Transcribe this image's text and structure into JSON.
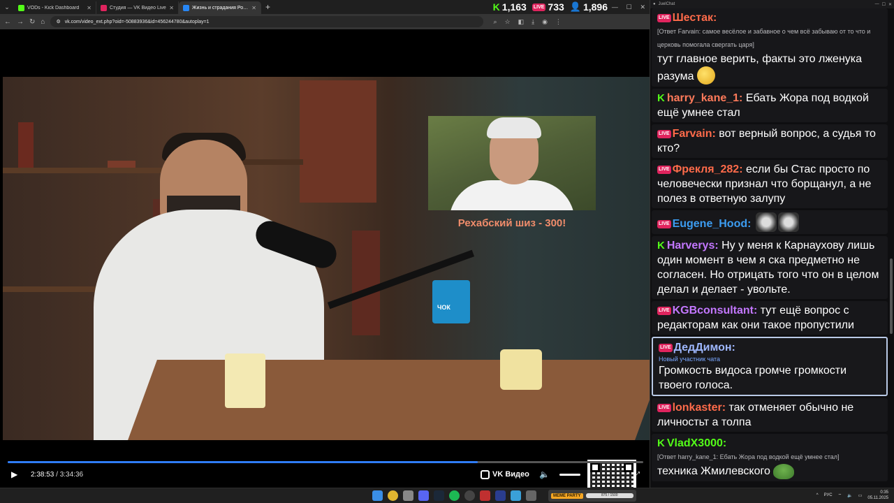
{
  "browser": {
    "tabs": [
      {
        "label": "VODs - Kick Dashboard",
        "icon": "kick-icon",
        "color": "#53fc18",
        "active": false
      },
      {
        "label": "Студия — VK Видео Live",
        "icon": "vk-live-icon",
        "color": "#e0245e",
        "active": false
      },
      {
        "label": "Жизнь и страдания Романа А",
        "icon": "vk-icon",
        "color": "#2787f5",
        "active": true
      }
    ],
    "new_tab": "+",
    "url": "vk.com/video_ext.php?oid=-50883936&id=456244780&autoplay=1"
  },
  "stats": {
    "kick_viewers": "1,163",
    "live_badge": "LIVE",
    "live_viewers": "733",
    "total_viewers": "1,896"
  },
  "video": {
    "overlay_text": "Рехабский шиз - 300!",
    "mug_label": "ЧОК",
    "current_time": "2:38:53",
    "separator": "/",
    "duration": "3:34:36",
    "progress": 0.74,
    "brand": "VK Видео"
  },
  "chat": {
    "title": "JuelChat",
    "live_badge": "LIVE",
    "messages": [
      {
        "badge": "live",
        "user": "Шестак:",
        "user_color": "#ff6b4a",
        "reply": "[Ответ Farvain: самое весёлое и забавное о чем всё забываю от то что и церковь помогала свергать царя]",
        "text": "тут главное верить, факты это лженука разума",
        "emote": "smile"
      },
      {
        "badge": "kick",
        "user": "harry_kane_1:",
        "user_color": "#ff7a5a",
        "text": "Ебать Жора под водкой ещё умнее стал"
      },
      {
        "badge": "live",
        "user": "Farvain:",
        "user_color": "#ff6b4a",
        "text": "вот верный вопрос, а судья то кто?"
      },
      {
        "badge": "live",
        "user": "Фрекля_282:",
        "user_color": "#ff6b4a",
        "text": "если бы Стас просто по человечески признал что борщанул, а не полез в ответную залупу"
      },
      {
        "badge": "live",
        "user": "Eugene_Hood:",
        "user_color": "#3c9cf0",
        "text": "",
        "emote": "face2"
      },
      {
        "badge": "kick",
        "user": "Harverys:",
        "user_color": "#c377ff",
        "text": "Ну у меня к Карнаухову лишь один момент в чем я ска предметно не согласен. Но отрицать того что он в целом делал и делает - увольте."
      },
      {
        "badge": "live",
        "user": "KGBconsultant:",
        "user_color": "#c377ff",
        "text": "тут ещё вопрос с редакторам как они такое пропустили"
      },
      {
        "badge": "live",
        "user": "ДедДимон:",
        "user_color": "#9fb8ff",
        "sub": "Новый участник чата",
        "text": "Громкость видоса громче громкости твоего голоса.",
        "highlight": true
      },
      {
        "badge": "live",
        "user": "lonkaster:",
        "user_color": "#ff6b4a",
        "text": "так отменяет обычно не личностьт а толпа"
      },
      {
        "badge": "kick",
        "user": "VladX3000:",
        "user_color": "#53fc18",
        "reply": "[Ответ harry_kane_1: Ебать Жора под водкой ещё умнее стал]",
        "text": "техника Жмилевского",
        "emote": "frog"
      }
    ]
  },
  "taskbar": {
    "mini_player_logo": "MEME PARTY",
    "mini_player_progress": "875 / 1500",
    "language": "РУС",
    "time": "0:35",
    "date": "05.11.2025"
  }
}
